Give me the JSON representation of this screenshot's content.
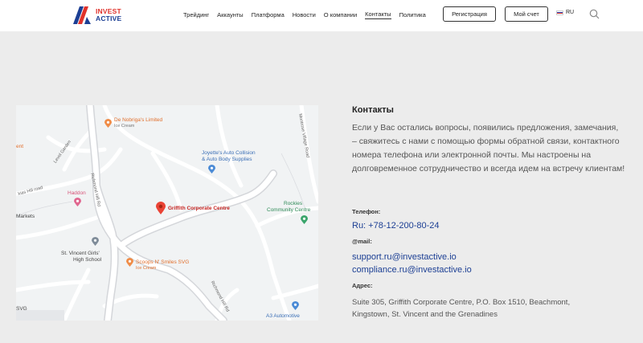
{
  "header": {
    "logo": {
      "line1": "INVEST",
      "line2": "ACTIVE"
    },
    "nav": [
      {
        "label": "Трейдинг",
        "active": false
      },
      {
        "label": "Аккаунты",
        "active": false
      },
      {
        "label": "Платформа",
        "active": false
      },
      {
        "label": "Новости",
        "active": false
      },
      {
        "label": "О компании",
        "active": false
      },
      {
        "label": "Контакты",
        "active": true
      },
      {
        "label": "Политика",
        "active": false
      }
    ],
    "register_label": "Регистрация",
    "account_label": "Мой счет",
    "language": "RU"
  },
  "map": {
    "places": {
      "denobriga": "De Nobriga's Limited",
      "denobriga_sub": "Ice Cream",
      "joyette_1": "Joyette's Auto Collision",
      "joyette_2": "& Auto Body Supplies",
      "haddon": "Haddon",
      "griffith": "Griffith Corporate Centre",
      "rockies_1": "Rockies",
      "rockies_2": "Community Centre",
      "markets": "Markets",
      "school_1": "St. Vincent Girls'",
      "school_2": "High School",
      "scoops": "Scoops N' Smiles SVG",
      "scoops_sub": "Ice Cream",
      "svg": "SVG",
      "a3": "A3 Automotive",
      "ment": "ent"
    },
    "roads": {
      "richmond_hill_rd_1": "Richmond Hill Rd",
      "richmond_hill_rd_2": "Richmond Hill Rd",
      "montrose_village_road": "Montrose Village Road",
      "level_garden": "Level Garden",
      "kias_hill_road": "kias Hill road"
    }
  },
  "contacts": {
    "title": "Контакты",
    "text": "Если у Вас остались вопросы, появились предложения, замечания, – свяжитесь с нами с помощью формы обратной связи, контактного номера телефона или электронной почты. Мы настроены на долговременное сотрудничество и всегда идем на встречу клиентам!",
    "phone_label": "Телефон:",
    "phone": "Ru: +78-12-200-80-24",
    "mail_label": "@mail:",
    "email_support": "support.ru@investactive.io",
    "email_compliance": "compliance.ru@investactive.io",
    "address_label": "Адрес:",
    "address": "Suite 305, Griffith Corporate Centre, P.O. Box 1510, Beachmont, Kingstown, St. Vincent and the Grenadines"
  }
}
